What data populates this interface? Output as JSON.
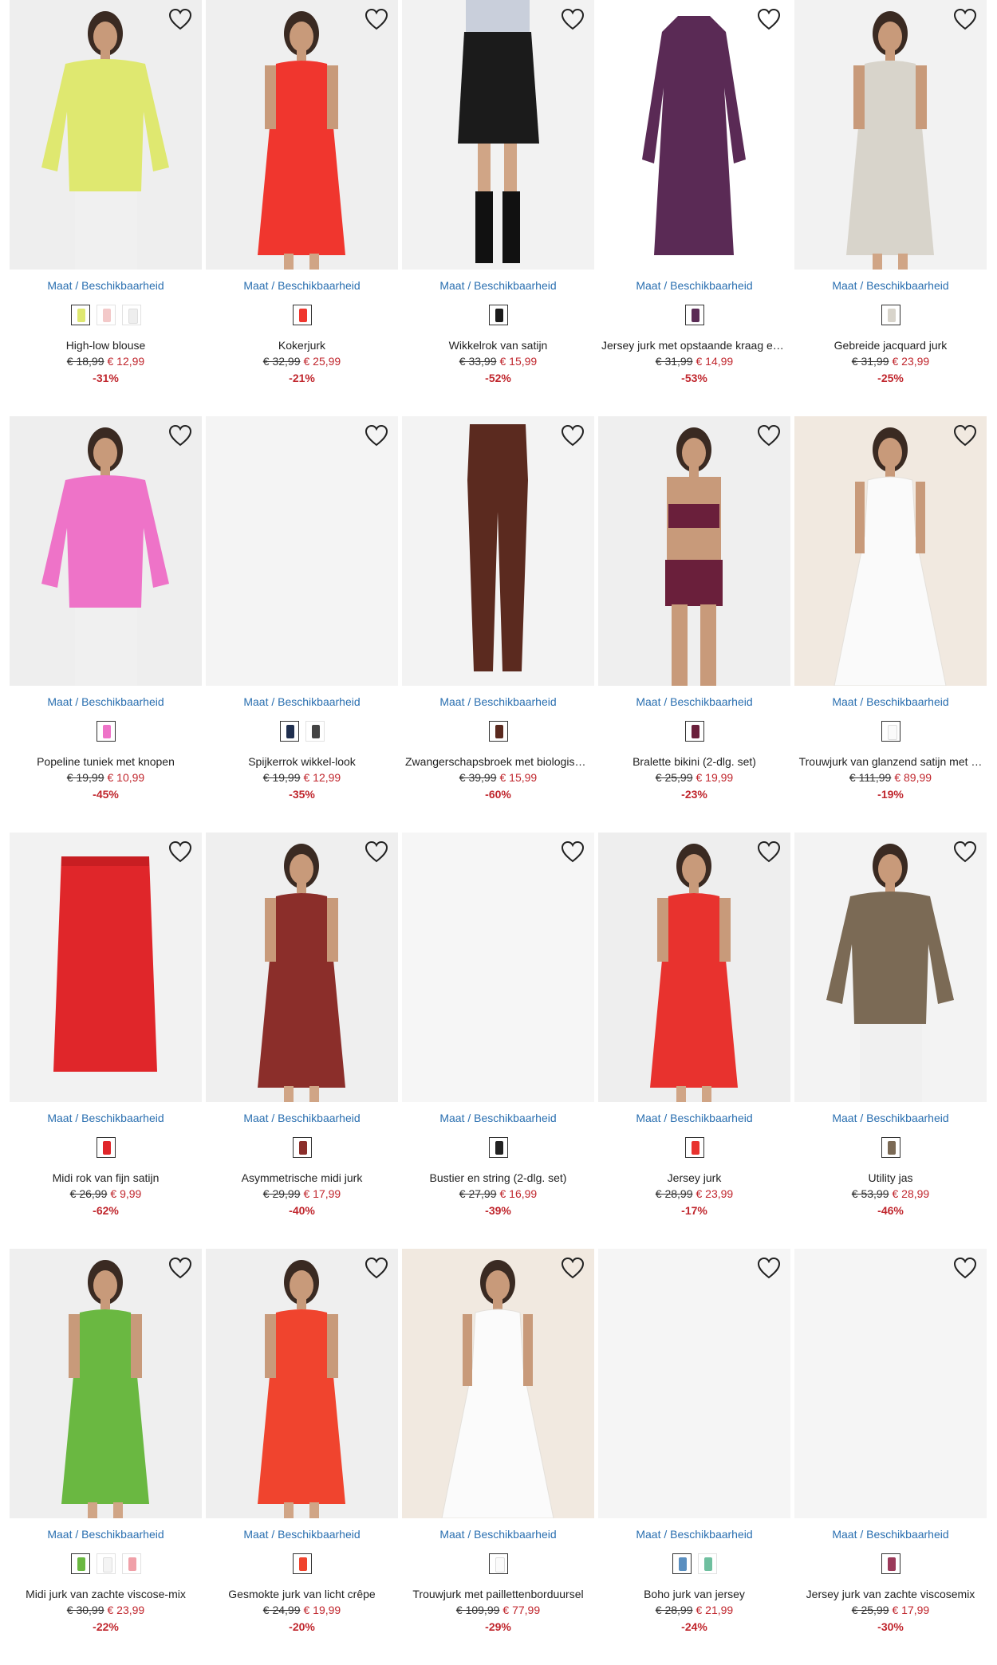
{
  "size_link_label": "Maat / Beschikbaarheid",
  "products": [
    {
      "name": "High-low blouse",
      "old_price": "€ 18,99",
      "new_price": "€ 12,99",
      "discount": "-31%",
      "bg": "#eeeeee",
      "color": "#dfe870",
      "swatches": [
        "#dfe870",
        "#f3c9c9",
        "#eeeeee"
      ],
      "shape": "top"
    },
    {
      "name": "Kokerjurk",
      "old_price": "€ 32,99",
      "new_price": "€ 25,99",
      "discount": "-21%",
      "bg": "#efefef",
      "color": "#f0362e",
      "swatches": [
        "#f0362e"
      ],
      "shape": "dress"
    },
    {
      "name": "Wikkelrok van satijn",
      "old_price": "€ 33,99",
      "new_price": "€ 15,99",
      "discount": "-52%",
      "bg": "#f2f2f2",
      "color": "#1b1b1b",
      "swatches": [
        "#1b1b1b"
      ],
      "shape": "skirt-model"
    },
    {
      "name": "Jersey jurk met opstaande kraag en…",
      "old_price": "€ 31,99",
      "new_price": "€ 14,99",
      "discount": "-53%",
      "bg": "#ffffff",
      "color": "#5a2a55",
      "swatches": [
        "#5a2a55"
      ],
      "shape": "flat-dress"
    },
    {
      "name": "Gebreide jacquard jurk",
      "old_price": "€ 31,99",
      "new_price": "€ 23,99",
      "discount": "-25%",
      "bg": "#f2f2f2",
      "color": "#d8d4cb",
      "swatches": [
        "#d8d4cb"
      ],
      "shape": "dress"
    },
    {
      "name": "Popeline tuniek met knopen",
      "old_price": "€ 19,99",
      "new_price": "€ 10,99",
      "discount": "-45%",
      "bg": "#eeeeee",
      "color": "#ee73c8",
      "swatches": [
        "#ee73c8"
      ],
      "shape": "top"
    },
    {
      "name": "Spijkerrok wikkel-look",
      "old_price": "€ 19,99",
      "new_price": "€ 12,99",
      "discount": "-35%",
      "bg": "#f4f4f4",
      "color": "#f4f4f4",
      "swatches": [
        "#1f2f4f",
        "#444444"
      ],
      "shape": "none"
    },
    {
      "name": "Zwangerschapsbroek met biologisc…",
      "old_price": "€ 39,99",
      "new_price": "€ 15,99",
      "discount": "-60%",
      "bg": "#f3f3f3",
      "color": "#5b2a1f",
      "swatches": [
        "#5b2a1f"
      ],
      "shape": "pants"
    },
    {
      "name": "Bralette bikini (2-dlg. set)",
      "old_price": "€ 25,99",
      "new_price": "€ 19,99",
      "discount": "-23%",
      "bg": "#efefef",
      "color": "#6a1f3b",
      "swatches": [
        "#6a1f3b"
      ],
      "shape": "bikini"
    },
    {
      "name": "Trouwjurk van glanzend satijn met …",
      "old_price": "€ 111,99",
      "new_price": "€ 89,99",
      "discount": "-19%",
      "bg": "#f1e9e0",
      "color": "#fafafa",
      "swatches": [
        "#fafafa"
      ],
      "shape": "gown"
    },
    {
      "name": "Midi rok van fijn satijn",
      "old_price": "€ 26,99",
      "new_price": "€ 9,99",
      "discount": "-62%",
      "bg": "#f2f2f2",
      "color": "#e0262a",
      "swatches": [
        "#e0262a"
      ],
      "shape": "flat-skirt"
    },
    {
      "name": "Asymmetrische midi jurk",
      "old_price": "€ 29,99",
      "new_price": "€ 17,99",
      "discount": "-40%",
      "bg": "#efefef",
      "color": "#8b2e2a",
      "swatches": [
        "#8b2e2a"
      ],
      "shape": "dress"
    },
    {
      "name": "Bustier en string (2-dlg. set)",
      "old_price": "€ 27,99",
      "new_price": "€ 16,99",
      "discount": "-39%",
      "bg": "#f6f6f6",
      "color": "#f6f6f6",
      "swatches": [
        "#222222"
      ],
      "shape": "none"
    },
    {
      "name": "Jersey jurk",
      "old_price": "€ 28,99",
      "new_price": "€ 23,99",
      "discount": "-17%",
      "bg": "#eeeeee",
      "color": "#e8322e",
      "swatches": [
        "#e8322e"
      ],
      "shape": "dress"
    },
    {
      "name": "Utility jas",
      "old_price": "€ 53,99",
      "new_price": "€ 28,99",
      "discount": "-46%",
      "bg": "#f3f3f3",
      "color": "#7b6a55",
      "swatches": [
        "#7b6a55"
      ],
      "shape": "top"
    },
    {
      "name": "Midi jurk van zachte viscose-mix",
      "old_price": "€ 30,99",
      "new_price": "€ 23,99",
      "discount": "-22%",
      "bg": "#efefef",
      "color": "#6ab841",
      "swatches": [
        "#6ab841",
        "#f4f4f4",
        "#f0a0a8"
      ],
      "shape": "dress"
    },
    {
      "name": "Gesmokte jurk van licht crêpe",
      "old_price": "€ 24,99",
      "new_price": "€ 19,99",
      "discount": "-20%",
      "bg": "#efefef",
      "color": "#f0442e",
      "swatches": [
        "#f0442e"
      ],
      "shape": "dress"
    },
    {
      "name": "Trouwjurk met paillettenborduursel",
      "old_price": "€ 109,99",
      "new_price": "€ 77,99",
      "discount": "-29%",
      "bg": "#f1e9e0",
      "color": "#fbfbfb",
      "swatches": [
        "#fbfbfb"
      ],
      "shape": "gown"
    },
    {
      "name": "Boho jurk van jersey",
      "old_price": "€ 28,99",
      "new_price": "€ 21,99",
      "discount": "-24%",
      "bg": "#f5f5f5",
      "color": "#f5f5f5",
      "swatches": [
        "#5a8fc0",
        "#6fbf9f"
      ],
      "shape": "none"
    },
    {
      "name": "Jersey jurk van zachte viscosemix",
      "old_price": "€ 25,99",
      "new_price": "€ 17,99",
      "discount": "-30%",
      "bg": "#f5f5f5",
      "color": "#f5f5f5",
      "swatches": [
        "#9b3a5a"
      ],
      "shape": "none"
    }
  ]
}
